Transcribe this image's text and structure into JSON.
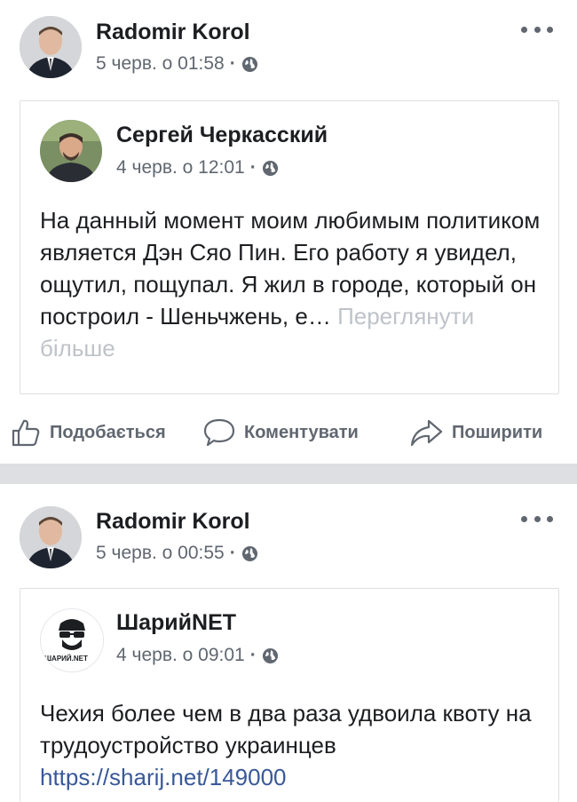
{
  "posts": [
    {
      "author": "Radomir Korol",
      "time": "5 черв. о 01:58",
      "shared": {
        "author": "Сергей Черкасский",
        "time": "4 черв. о 12:01",
        "text": "На данный момент моим любимым политиком является Дэн Сяо Пин. Его работу я увидел, ощутил, пощупал. Я жил в городе, который он построил - Шеньчжень, е…",
        "see_more": "Переглянути більше"
      },
      "actions": [
        {
          "label": "Подобається",
          "icon": "like-icon"
        },
        {
          "label": "Коментувати",
          "icon": "comment-icon"
        },
        {
          "label": "Поширити",
          "icon": "share-icon"
        }
      ]
    },
    {
      "author": "Radomir Korol",
      "time": "5 черв. о 00:55",
      "shared": {
        "author": "ШарийNET",
        "time": "4 черв. о 09:01",
        "avatar_text": "ШАРИЙ.NET",
        "text": "Чехия более чем в два раза удвоила квоту на трудоустройство украинцев",
        "link": "https://sharij.net/149000"
      }
    }
  ],
  "colors": {
    "text": "#1c1e21",
    "meta": "#606770",
    "link": "#385898",
    "see_more": "#bec3c9",
    "separator": "#dddfe2"
  }
}
